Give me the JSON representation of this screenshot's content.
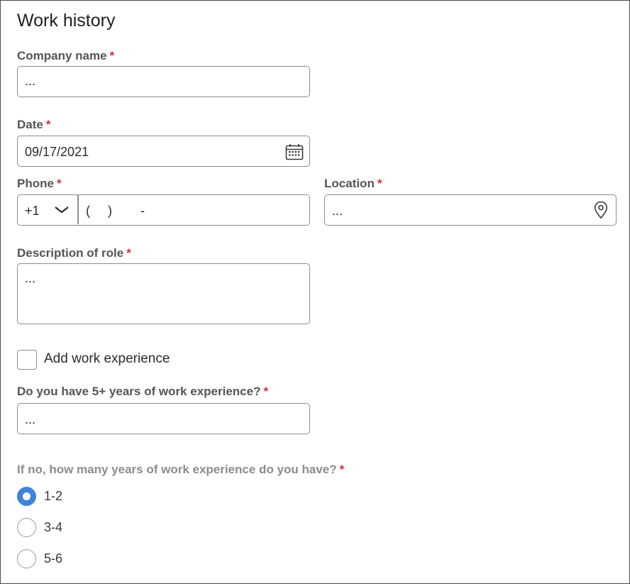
{
  "form": {
    "title": "Work history",
    "required_marker": "*",
    "company": {
      "label": "Company name",
      "value": "..."
    },
    "date": {
      "label": "Date",
      "value": "09/17/2021",
      "icon": "calendar-icon"
    },
    "phone": {
      "label": "Phone",
      "country_code": "+1",
      "number_mask": "(     )        -",
      "icon": "chevron-down-icon"
    },
    "location": {
      "label": "Location",
      "value": "...",
      "icon": "map-pin-icon"
    },
    "description": {
      "label": "Description of role",
      "value": "..."
    },
    "add_experience": {
      "label": "Add work experience",
      "checked": false
    },
    "five_plus": {
      "label": "Do you have 5+ years of work experience?",
      "value": "..."
    },
    "years": {
      "label": "If no, how many years of work experience do you have?",
      "options": [
        {
          "label": "1-2",
          "selected": true
        },
        {
          "label": "3-4",
          "selected": false
        },
        {
          "label": "5-6",
          "selected": false
        }
      ]
    }
  },
  "colors": {
    "accent": "#3d85d8",
    "required": "#d32f3a",
    "border": "#8e8e8e"
  }
}
